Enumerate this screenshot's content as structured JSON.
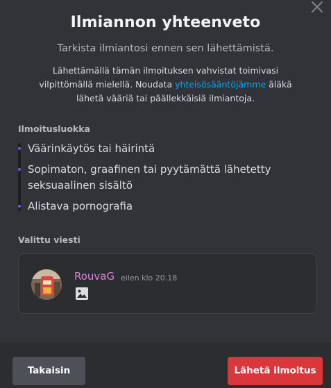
{
  "dialog": {
    "title": "Ilmiannon yhteenveto",
    "subtitle": "Tarkista ilmiantosi ennen sen lähettämistä.",
    "notice_before_link": "Lähettämällä tämän ilmoituksen vahvistat toimivasi vilpittömällä mielellä. Noudata ",
    "notice_link": "yhteisösääntöjämme",
    "notice_after_link": " äläkä lähetä vääriä tai päällekkäisiä ilmiantoja.",
    "close_icon": "close-icon"
  },
  "category": {
    "label": "Ilmoitusluokka",
    "items": [
      "Väärinkäytös tai häirintä",
      "Sopimaton, graafinen tai pyytämättä lähetetty seksuaalinen sisältö",
      "Alistava pornografia"
    ]
  },
  "message": {
    "label": "Valittu viesti",
    "author": "RouvaG",
    "timestamp": "eilen klo 20.18",
    "attachment_icon": "image-icon",
    "author_color": "#dd83dc"
  },
  "footer": {
    "back_label": "Takaisin",
    "submit_label": "Lähetä ilmoitus",
    "submit_color": "#da373c"
  },
  "colors": {
    "background": "#313338",
    "footer": "#2b2d31",
    "link": "#00a8fc",
    "bullet": "#5865f2"
  }
}
